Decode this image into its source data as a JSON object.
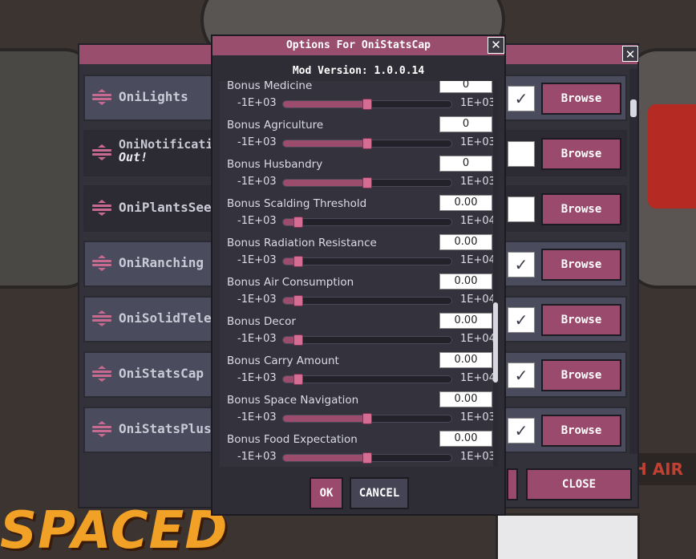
{
  "background": {
    "logo_text": "SPACED",
    "sign_text": "H AIR"
  },
  "mods_window": {
    "close_glyph": "✕",
    "rows": [
      {
        "title": "OniLights",
        "subtitle": "",
        "checked": true,
        "browse": "Browse"
      },
      {
        "title": "OniNotificationTr",
        "subtitle": "Out!",
        "checked": false,
        "browse": "Browse"
      },
      {
        "title": "OniPlantsSeed -",
        "subtitle": "",
        "checked": false,
        "browse": "Browse"
      },
      {
        "title": "OniRanching",
        "subtitle": "",
        "checked": true,
        "browse": "Browse"
      },
      {
        "title": "OniSolidTeleport",
        "subtitle": "",
        "checked": true,
        "browse": "Browse"
      },
      {
        "title": "OniStatsCap",
        "subtitle": "",
        "checked": true,
        "browse": "Browse"
      },
      {
        "title": "OniStatsPlus",
        "subtitle": "",
        "checked": true,
        "browse": "Browse"
      }
    ],
    "close_button": "CLOSE"
  },
  "dialog": {
    "title": "Options For OniStatsCap",
    "close_glyph": "✕",
    "mod_version": "Mod Version: 1.0.0.14",
    "options": [
      {
        "label": "Bonus Medicine",
        "value": "0",
        "min": "-1E+03",
        "max": "1E+03",
        "position": 0.5
      },
      {
        "label": "Bonus Agriculture",
        "value": "0",
        "min": "-1E+03",
        "max": "1E+03",
        "position": 0.5
      },
      {
        "label": "Bonus Husbandry",
        "value": "0",
        "min": "-1E+03",
        "max": "1E+03",
        "position": 0.5
      },
      {
        "label": "Bonus Scalding Threshold",
        "value": "0.00",
        "min": "-1E+03",
        "max": "1E+04",
        "position": 0.09
      },
      {
        "label": "Bonus Radiation Resistance",
        "value": "0.00",
        "min": "-1E+03",
        "max": "1E+04",
        "position": 0.09
      },
      {
        "label": "Bonus Air Consumption",
        "value": "0.00",
        "min": "-1E+03",
        "max": "1E+04",
        "position": 0.09
      },
      {
        "label": "Bonus Decor",
        "value": "0.00",
        "min": "-1E+03",
        "max": "1E+04",
        "position": 0.09
      },
      {
        "label": "Bonus Carry Amount",
        "value": "0.00",
        "min": "-1E+03",
        "max": "1E+04",
        "position": 0.09
      },
      {
        "label": "Bonus Space Navigation",
        "value": "0.00",
        "min": "-1E+03",
        "max": "1E+03",
        "position": 0.5
      },
      {
        "label": "Bonus Food Expectation",
        "value": "0.00",
        "min": "-1E+03",
        "max": "1E+03",
        "position": 0.5
      }
    ],
    "ok_label": "OK",
    "cancel_label": "CANCEL"
  },
  "colors": {
    "accent": "#9a4e6d",
    "slider_handle": "#d56d92",
    "panel": "#2e2d36"
  }
}
